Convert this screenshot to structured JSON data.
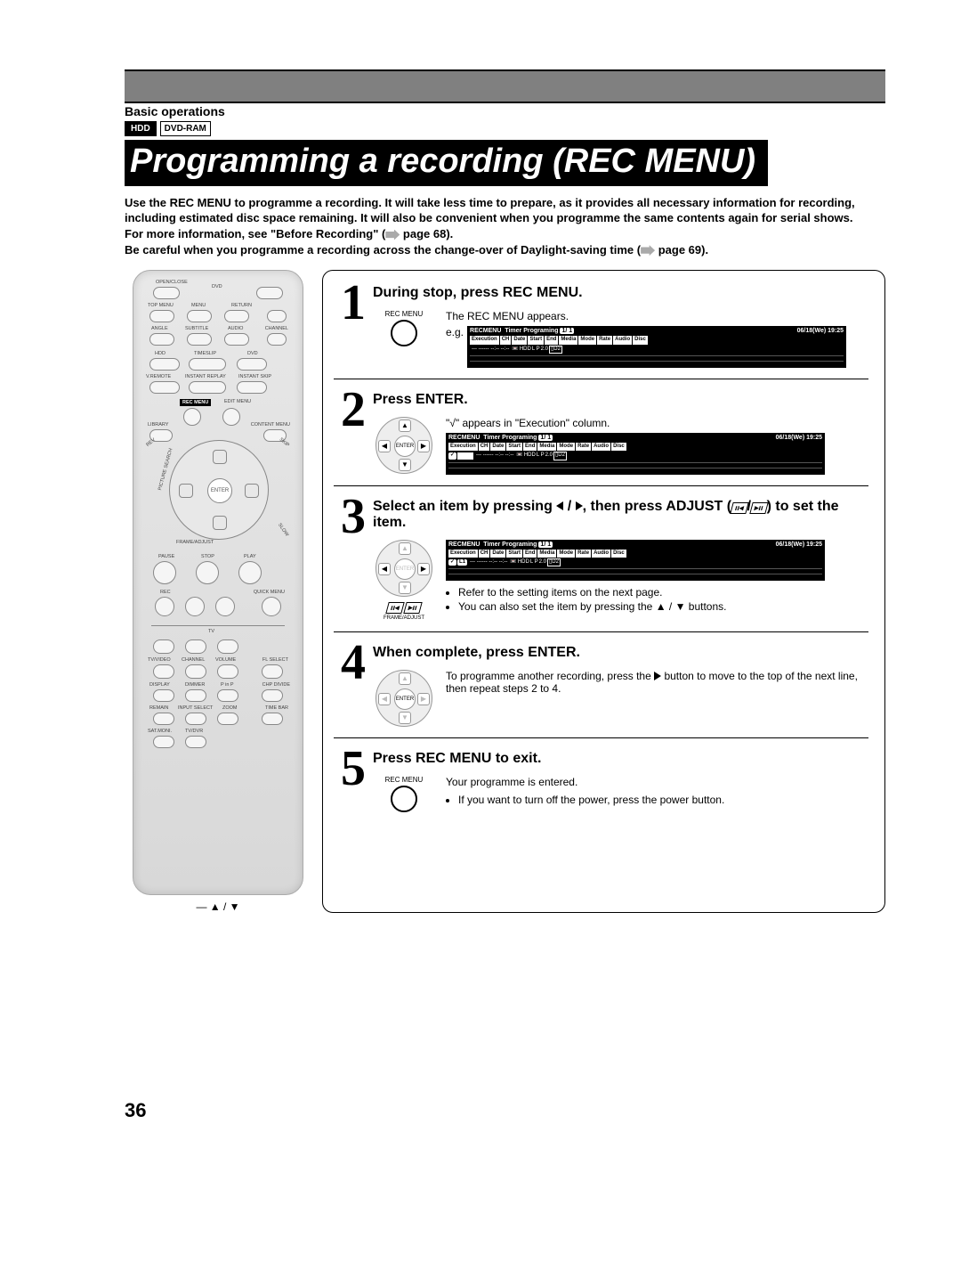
{
  "header": {
    "section": "Basic operations",
    "badges": {
      "hdd": "HDD",
      "dvd": "DVD-RAM"
    },
    "title": "Programming a recording (REC MENU)"
  },
  "intro": {
    "line1": "Use the REC MENU to programme a recording. It will take less time to prepare, as it provides all necessary information for recording, including estimated disc space remaining. It will also be convenient when you programme the same contents again for serial shows.",
    "line2a": "For more information, see \"Before Recording\" (",
    "line2b": " page 68).",
    "line3a": "Be careful when you programme a recording across the change-over of Daylight-saving time (",
    "line3b": " page 69)."
  },
  "remote": {
    "legend": "▲ / ▼",
    "labels": {
      "openclose": "OPEN/CLOSE",
      "dvd": "DVD",
      "topmenu": "TOP MENU",
      "menu": "MENU",
      "return": "RETURN",
      "angle": "ANGLE",
      "subtitle": "SUBTITLE",
      "audio": "AUDIO",
      "channel": "CHANNEL",
      "hdd": "HDD",
      "timeslip": "TIMESLIP",
      "dvd2": "DVD",
      "vremote": "V.REMOTE",
      "instantreplay": "INSTANT REPLAY",
      "instantskip": "INSTANT SKIP",
      "recmenu": "REC MENU",
      "editmenu": "EDIT MENU",
      "library": "LIBRARY",
      "contentmenu": "CONTENT MENU",
      "enter": "ENTER",
      "pause": "PAUSE",
      "stop": "STOP",
      "play": "PLAY",
      "rec": "REC",
      "quick": "QUICK MENU",
      "tv": "TV",
      "tvvideo": "TV/VIDEO",
      "channel2": "CHANNEL",
      "volume": "VOLUME",
      "flselect": "FL SELECT",
      "display": "DISPLAY",
      "dimmer": "DIMMER",
      "pinp": "P in P",
      "chpdivide": "CHP DIVIDE",
      "remain": "REMAIN",
      "inputselect": "INPUT SELECT",
      "zoom": "ZOOM",
      "timebar": "TIME BAR",
      "satmoni": "SAT.MONI.",
      "tvdvr": "TV/DVR",
      "slow": "SLOW",
      "rev": "REV",
      "skip": "SKIP",
      "picturesearch": "PICTURE SEARCH",
      "frameadjust": "FRAME/ADJUST"
    }
  },
  "timer_menu": {
    "title_rec": "REC",
    "title_menu": "MENU",
    "label": "Timer Programing",
    "index": "1/ 1",
    "datetime": "06/18(We) 19:25",
    "cols": [
      "Execution",
      "CH",
      "Date",
      "Start",
      "End",
      "Media",
      "Mode",
      "Rate",
      "Audio",
      "Disc"
    ],
    "row_dashes": "---  ------  --:--  --:--",
    "media": "HDD",
    "mode": "L P",
    "rate": "2.0",
    "audio": "D2",
    "ch_l1": "L1"
  },
  "steps": {
    "s1": {
      "num": "1",
      "title": "During stop, press REC MENU.",
      "line": "The REC MENU appears.",
      "eg": "e.g.",
      "icon_label": "REC MENU"
    },
    "s2": {
      "num": "2",
      "title": "Press ENTER.",
      "line": "\"√\" appears in \"Execution\" column.",
      "enter": "ENTER",
      "check": "✓"
    },
    "s3": {
      "num": "3",
      "title_a": "Select an item by pressing ",
      "title_b": " / ",
      "title_c": ", then press ADJUST (",
      "title_d": ") to set the item.",
      "adjust_icons": "◂◂/▸◂",
      "bullet1": "Refer to the setting items on the next page.",
      "bullet2": "You can also set the item by pressing the ▲ / ▼ buttons."
    },
    "s4": {
      "num": "4",
      "title": "When complete, press ENTER.",
      "line_a": "To programme another recording, press the ",
      "line_b": " button to move to the top of the next line, then repeat steps 2 to 4.",
      "enter": "ENTER"
    },
    "s5": {
      "num": "5",
      "title": "Press REC MENU to exit.",
      "line": "Your programme is entered.",
      "bullet": "If you want to turn off the power, press the power button.",
      "icon_label": "REC MENU"
    }
  },
  "page_number": "36"
}
